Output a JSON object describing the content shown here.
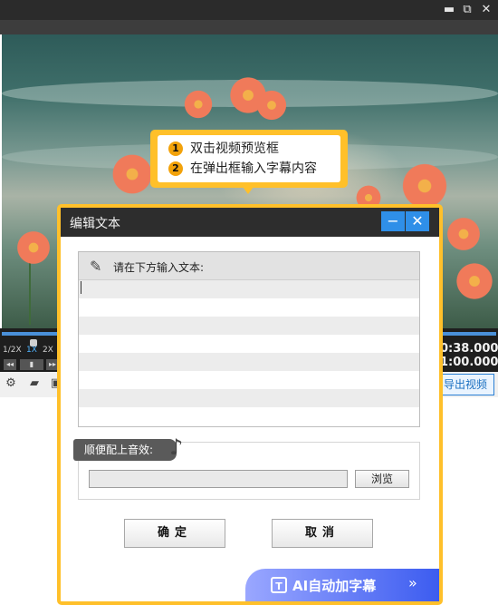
{
  "window": {
    "restore_glyph": "⧉",
    "close_glyph": "✕"
  },
  "hint": {
    "step1_num": "1",
    "step1_text": "双击视频预览框",
    "step2_num": "2",
    "step2_text": "在弹出框输入字幕内容"
  },
  "player": {
    "speeds": [
      "1/2X",
      "1X",
      "2X"
    ],
    "current_time": "0:38.000",
    "total_time": "1:00.000",
    "export_label": "导出视频"
  },
  "dialog": {
    "title": "编辑文本",
    "minimize_glyph": "−",
    "close_glyph": "✕",
    "text_prompt": "请在下方输入文本:",
    "text_value": "",
    "sound_label": "顺便配上音效:",
    "sound_path": "",
    "browse_label": "浏览",
    "ok_label": "确定",
    "cancel_label": "取消",
    "ai_label": "AI自动加字幕",
    "ai_icon_glyph": "T",
    "ai_arrow_glyph": "»"
  },
  "colors": {
    "accent": "#ffc02a",
    "blue": "#2f8fe8"
  }
}
